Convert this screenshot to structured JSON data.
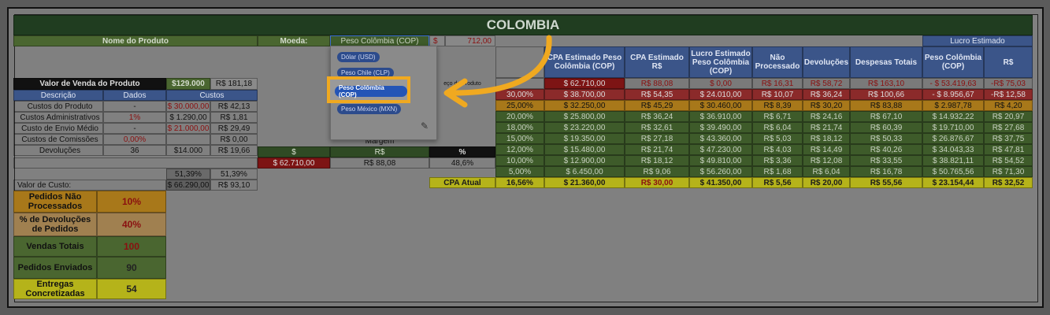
{
  "title": "COLOMBIA",
  "header": {
    "nome_produto": "Nome do Produto",
    "moeda_label": "Moeda:",
    "moeda_value": "Peso Colômbia (COP)",
    "currency_symbol": "$",
    "rate": "712,00",
    "lucro_estimado": "Lucro Estimado"
  },
  "dropdown": {
    "options": [
      "Dólar (USD)",
      "Peso Chile (CLP)",
      "Peso Colômbia (COP)",
      "Peso México (MXN)"
    ],
    "selected": "Peso Colômbia (COP)",
    "edit_icon": "pencil-icon",
    "behind_text": "eço do Produto"
  },
  "left": {
    "valor_venda_label": "Valor de Venda do Produto",
    "valor_venda_cop": "$129.000",
    "valor_venda_brl": "R$ 181,18",
    "cols": [
      "Descrição",
      "Dados",
      "Custos"
    ],
    "rows": [
      {
        "desc": "Custos do Produto",
        "dados": "-",
        "custo": "$ 30.000,00",
        "brl": "R$ 42,13"
      },
      {
        "desc": "Custos Administrativos",
        "dados": "1%",
        "custo": "$ 1.290,00",
        "brl": "R$ 1,81"
      },
      {
        "desc": "Custo de Envio Médio",
        "dados": "-",
        "custo": "$ 21.000,00",
        "brl": "R$ 29,49"
      },
      {
        "desc": "Custos de Comissões",
        "dados": "0,00%",
        "custo": "",
        "brl": "R$ 0,00"
      },
      {
        "desc": "Devoluções",
        "dados": "36",
        "custo": "$14.000",
        "brl": "R$ 19,66"
      }
    ],
    "pct1": "51,39%",
    "pct2": "51,39%",
    "valor_custo_label": "Valor de Custo:",
    "valor_custo_cop": "$ 66.290,00",
    "valor_custo_brl": "R$ 93,10"
  },
  "margem": {
    "label": "Margem",
    "h1": "$",
    "h2": "R$",
    "h3": "%",
    "v1": "$ 62.710,00",
    "v2": "R$ 88,08",
    "v3": "48,6%"
  },
  "stats": [
    {
      "label": "Pedidos Não Processados",
      "value": "10%"
    },
    {
      "label": "% de Devoluções de Pedidos",
      "value": "40%"
    },
    {
      "label": "Vendas Totais",
      "value": "100"
    },
    {
      "label": "Pedidos Enviados",
      "value": "90"
    },
    {
      "label": "Entregas Concretizadas",
      "value": "54"
    }
  ],
  "table": {
    "headers": [
      "CPA Estimado Peso Colômbia (COP)",
      "CPA Estimado R$",
      "Lucro Estimado Peso Colômbia (COP)",
      "Não Processado",
      "Devoluções",
      "Despesas Totais",
      "Peso Colômbia (COP)",
      "R$"
    ],
    "rows": [
      {
        "pct": "",
        "c": [
          "$ 62.710,00",
          "R$ 88,08",
          "$ 0,00",
          "R$ 16,31",
          "R$ 58,72",
          "R$ 163,10",
          "- $ 53.419,63",
          "-R$ 75,03"
        ]
      },
      {
        "pct": "30,00%",
        "c": [
          "$ 38.700,00",
          "R$ 54,35",
          "$ 24.010,00",
          "R$ 10,07",
          "R$ 36,24",
          "R$ 100,66",
          "- $ 8.956,67",
          "-R$ 12,58"
        ]
      },
      {
        "pct": "25,00%",
        "c": [
          "$ 32.250,00",
          "R$ 45,29",
          "$ 30.460,00",
          "R$ 8,39",
          "R$ 30,20",
          "R$ 83,88",
          "$ 2.987,78",
          "R$ 4,20"
        ]
      },
      {
        "pct": "20,00%",
        "c": [
          "$ 25.800,00",
          "R$ 36,24",
          "$ 36.910,00",
          "R$ 6,71",
          "R$ 24,16",
          "R$ 67,10",
          "$ 14.932,22",
          "R$ 20,97"
        ]
      },
      {
        "pct": "18,00%",
        "c": [
          "$ 23.220,00",
          "R$ 32,61",
          "$ 39.490,00",
          "R$ 6,04",
          "R$ 21,74",
          "R$ 60,39",
          "$ 19.710,00",
          "R$ 27,68"
        ]
      },
      {
        "pct": "15,00%",
        "c": [
          "$ 19.350,00",
          "R$ 27,18",
          "$ 43.360,00",
          "R$ 5,03",
          "R$ 18,12",
          "R$ 50,33",
          "$ 26.876,67",
          "R$ 37,75"
        ]
      },
      {
        "pct": "12,00%",
        "c": [
          "$ 15.480,00",
          "R$ 21,74",
          "$ 47.230,00",
          "R$ 4,03",
          "R$ 14,49",
          "R$ 40,26",
          "$ 34.043,33",
          "R$ 47,81"
        ]
      },
      {
        "pct": "10,00%",
        "c": [
          "$ 12.900,00",
          "R$ 18,12",
          "$ 49.810,00",
          "R$ 3,36",
          "R$ 12,08",
          "R$ 33,55",
          "$ 38.821,11",
          "R$ 54,52"
        ]
      },
      {
        "pct": "5,00%",
        "c": [
          "$ 6.450,00",
          "R$ 9,06",
          "$ 56.260,00",
          "R$ 1,68",
          "R$ 6,04",
          "R$ 16,78",
          "$ 50.765,56",
          "R$ 71,30"
        ]
      }
    ],
    "cpa_atual_label": "CPA Atual",
    "cpa_atual": {
      "pct": "16,56%",
      "c": [
        "$ 21.360,00",
        "R$ 30,00",
        "$ 41.350,00",
        "R$ 5,56",
        "R$ 20,00",
        "R$ 55,56",
        "$ 23.154,44",
        "R$ 32,52"
      ]
    }
  },
  "colors": {
    "accent": "#f0a920",
    "select": "#2455b6"
  }
}
